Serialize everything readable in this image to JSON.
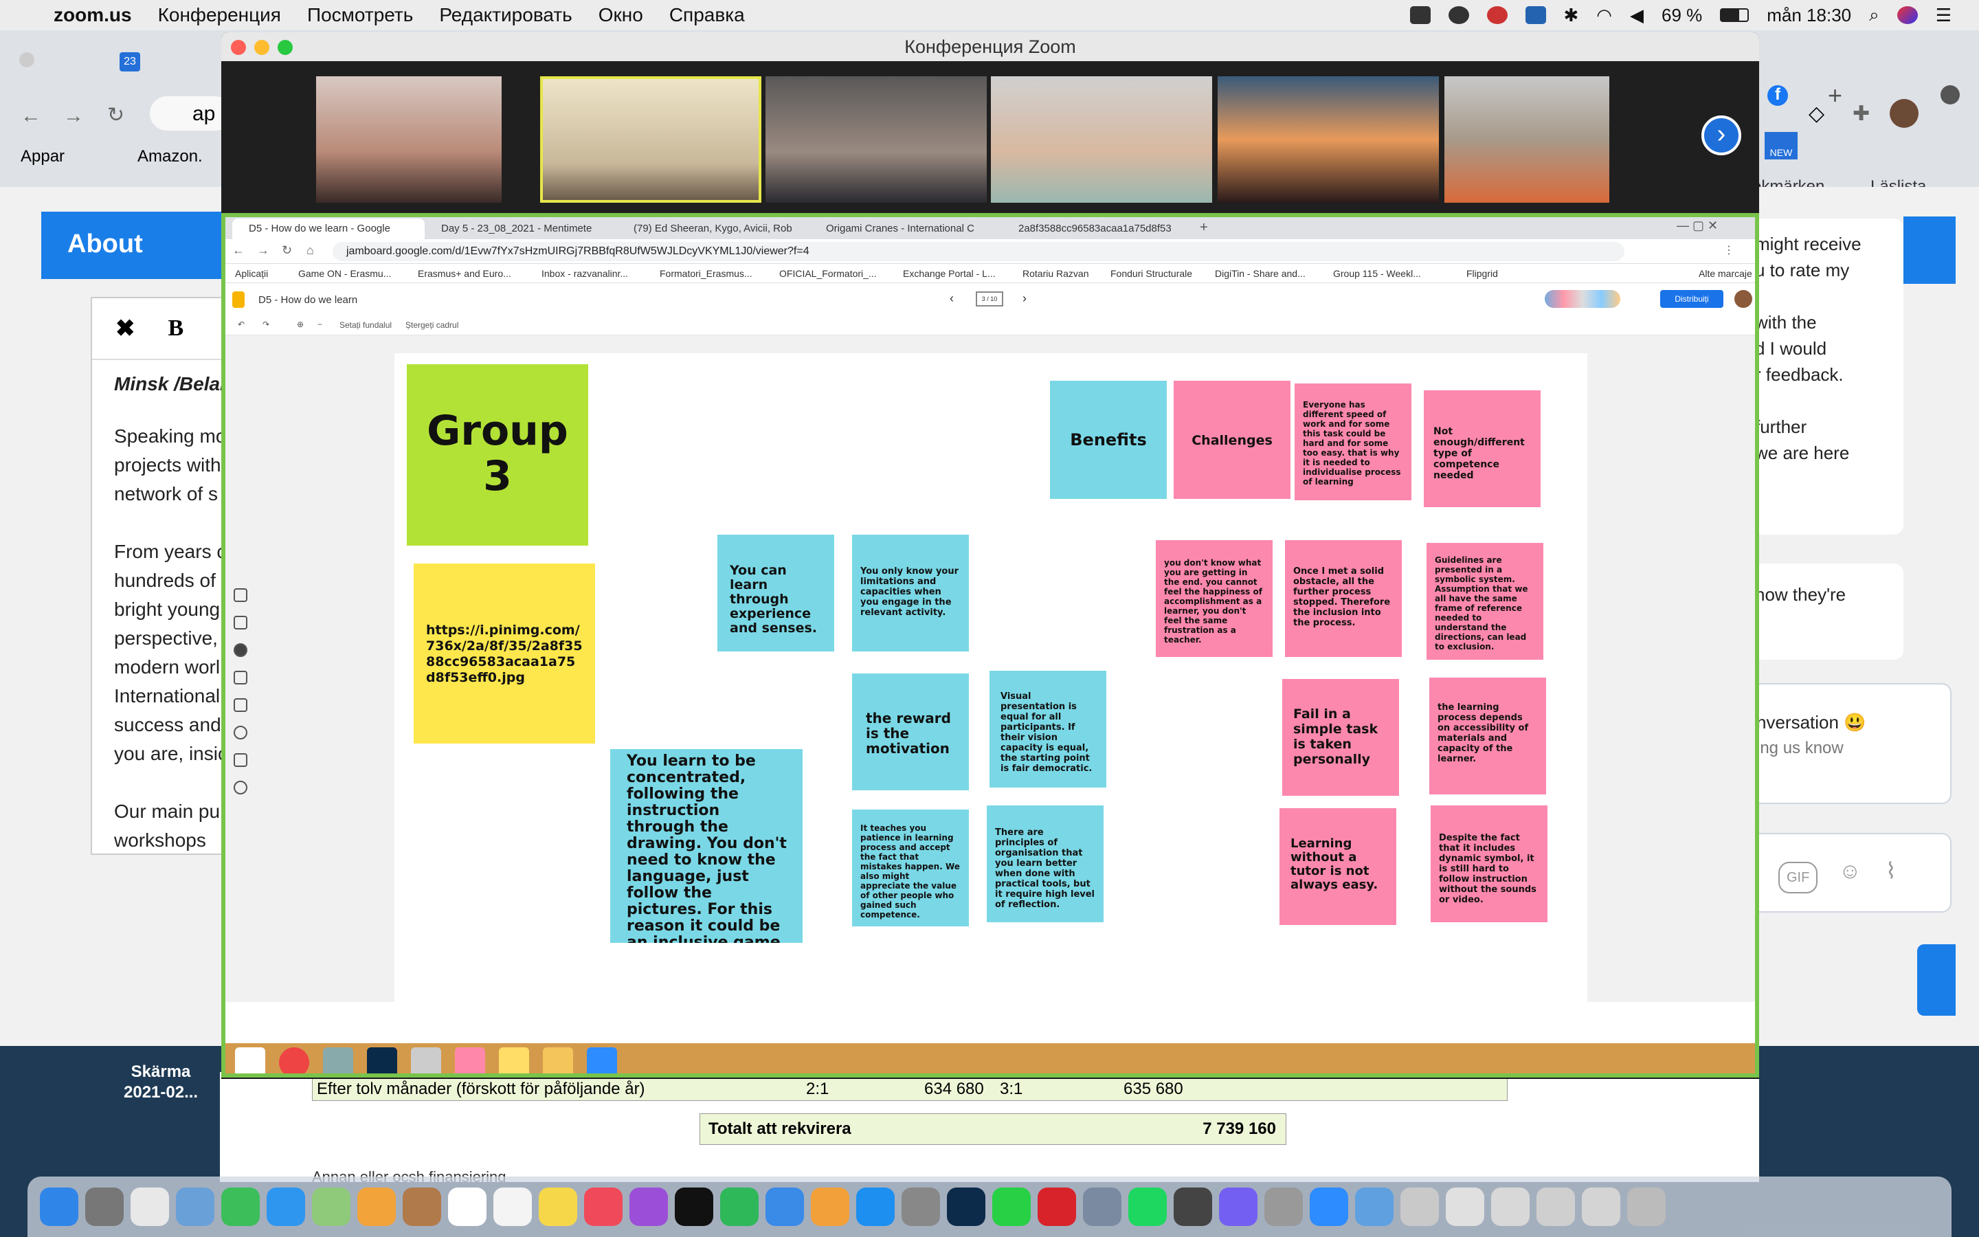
{
  "menubar": {
    "app_name": "zoom.us",
    "items": [
      "Konferencia",
      "Posmotret",
      "Redaktirovat",
      "Okno",
      "Spravka"
    ],
    "items_display": [
      "Конференция",
      "Посмотреть",
      "Редактировать",
      "Окно",
      "Справка"
    ],
    "battery": "69 %",
    "clock": "mån 18:30"
  },
  "background": {
    "about_title": "About",
    "editor_bold": "B",
    "editor_close": "✖",
    "editor_lines": [
      "Minsk /Belar",
      "Speaking mo",
      "projects with",
      "network of s",
      "From years c",
      "hundreds of",
      "bright young",
      "perspective,",
      "modern worl",
      "International",
      "success and",
      "you are, insic",
      "Our main pu",
      "workshops"
    ],
    "browser_tab_badge": "23",
    "address_partial": "ap",
    "bookmark_apps": "Appar",
    "bookmark_amazon": "Amazon.",
    "bookmark_right": "okmärken",
    "reading_list": "Läslista",
    "new_badge": "NEW",
    "chat_lines": [
      "might receive",
      "u to rate my",
      "with the",
      "d I would",
      "r feedback.",
      "further",
      "we are here",
      "how they're",
      "nversation 😃",
      "ing us know"
    ],
    "gif_label": "GIF",
    "desktop_label_1": "Skärma",
    "desktop_label_2": "2021-02...",
    "sheet_row1_label": "Efter tolv månader (förskott för påföljande år)",
    "sheet_row1_ratio1": "2:1",
    "sheet_row1_val1": "634 680",
    "sheet_row1_ratio2": "3:1",
    "sheet_row1_val2": "635 680",
    "sheet_total_label": "Totalt att rekvirera",
    "sheet_total_value": "7 739 160",
    "sheet_cut_text": "Annan eller ocsh finansiering"
  },
  "zoom": {
    "window_title": "Конференция Zoom"
  },
  "share": {
    "tabs": [
      "D5 - How do we learn - Google",
      "Day 5 - 23_08_2021 - Mentimete",
      "(79) Ed Sheeran, Kygo, Avicii, Rob",
      "Origami Cranes - International C",
      "2a8f3588cc96583acaa1a75d8f53"
    ],
    "url": "jamboard.google.com/d/1Evw7fYx7sHzmUIRGj7RBBfqR8UfW5WJLDcyVKYML1J0/viewer?f=4",
    "bookmarks": [
      "Aplicații",
      "Game ON - Erasmu...",
      "Erasmus+ and Euro...",
      "Inbox - razvanalinr...",
      "Formatori_Erasmus...",
      "OFICIAL_Formatori_...",
      "Exchange Portal - L...",
      "Rotariu Razvan",
      "Fonduri Structurale",
      "DigiTin - Share and...",
      "Group 115 - Weekl...",
      "Flipgrid",
      "Alte marcaje"
    ],
    "jam_title": "D5 - How do we learn",
    "frame_counter": "3 / 10",
    "share_button": "Distribuiți",
    "tool_bg": "Setați fundalul",
    "tool_clear": "Ștergeți cadrul",
    "zoom_symbol": "−"
  },
  "board": {
    "group_title": "Group 3",
    "link_note": "https://i.pinimg.com/736x/2a/8f/35/2a8f3588cc96583acaa1a75d8f53eff0.jpg",
    "learn_drawing": "You learn to be concentrated, following the instruction through the drawing. You don't need to know the language, just follow the pictures. For this reason it could be an inclusive game for those pupils with different background or for who has linguistic/cognitive problem.",
    "benefits": "Benefits",
    "challenges": "Challenges",
    "n_speed": "Everyone has different speed of work and for some this task could be hard and for some too easy. that is why it is needed to individualise process of learning",
    "n_notenough": "Not enough/different type of competence needed",
    "n_experience": "You can learn through experience and senses.",
    "n_limitations": "You only know your limitations and capacities when you engage in the relevant activity.",
    "n_dontknow": "you don't know what you are getting in the end. you cannot feel the happiness of accomplishment as a learner, you don't feel the same frustration as a teacher.",
    "n_obstacle": "Once I met a solid obstacle, all the further process stopped. Therefore the inclusion into the process.",
    "n_guidelines": "Guidelines are presented in a symbolic system. Assumption that we all have the same frame of reference needed to understand the directions, can lead to exclusion.",
    "n_reward": "the reward is the motivation",
    "n_visual": "Visual presentation is equal for all participants. If their vision capacity is equal, the starting point is fair democratic.",
    "n_fail": "Fail in a simple task is taken personally",
    "n_depends": "the learning process depends on accessibility of materials and capacity of the learner.",
    "n_patience": "It teaches you patience in learning process and accept the fact that mistakes happen. We also might appreciate the value of other people who gained such competence.",
    "n_principles": "There are principles of organisation that you learn better when done with practical tools, but it require high level of reflection.",
    "n_tutor": "Learning without a tutor is not always easy.",
    "n_symbol": "Despite the fact that it includes dynamic symbol, it is still hard to follow instruction without the sounds or video."
  },
  "colors": {
    "green_note": "#b3e236",
    "yellow_note": "#fde74c",
    "cyan_note": "#7ad8e6",
    "pink_note": "#fd88ad",
    "share_border": "#78c44a",
    "zoom_blue": "#1e6fd9"
  },
  "icons": [
    "apple-icon",
    "search-icon",
    "wifi-icon",
    "battery-icon",
    "next-arrow-icon",
    "pen-icon",
    "eraser-icon",
    "select-icon",
    "sticky-note-icon",
    "image-icon",
    "circle-icon",
    "text-box-icon",
    "laser-icon",
    "undo-icon",
    "redo-icon",
    "zoom-icon"
  ]
}
